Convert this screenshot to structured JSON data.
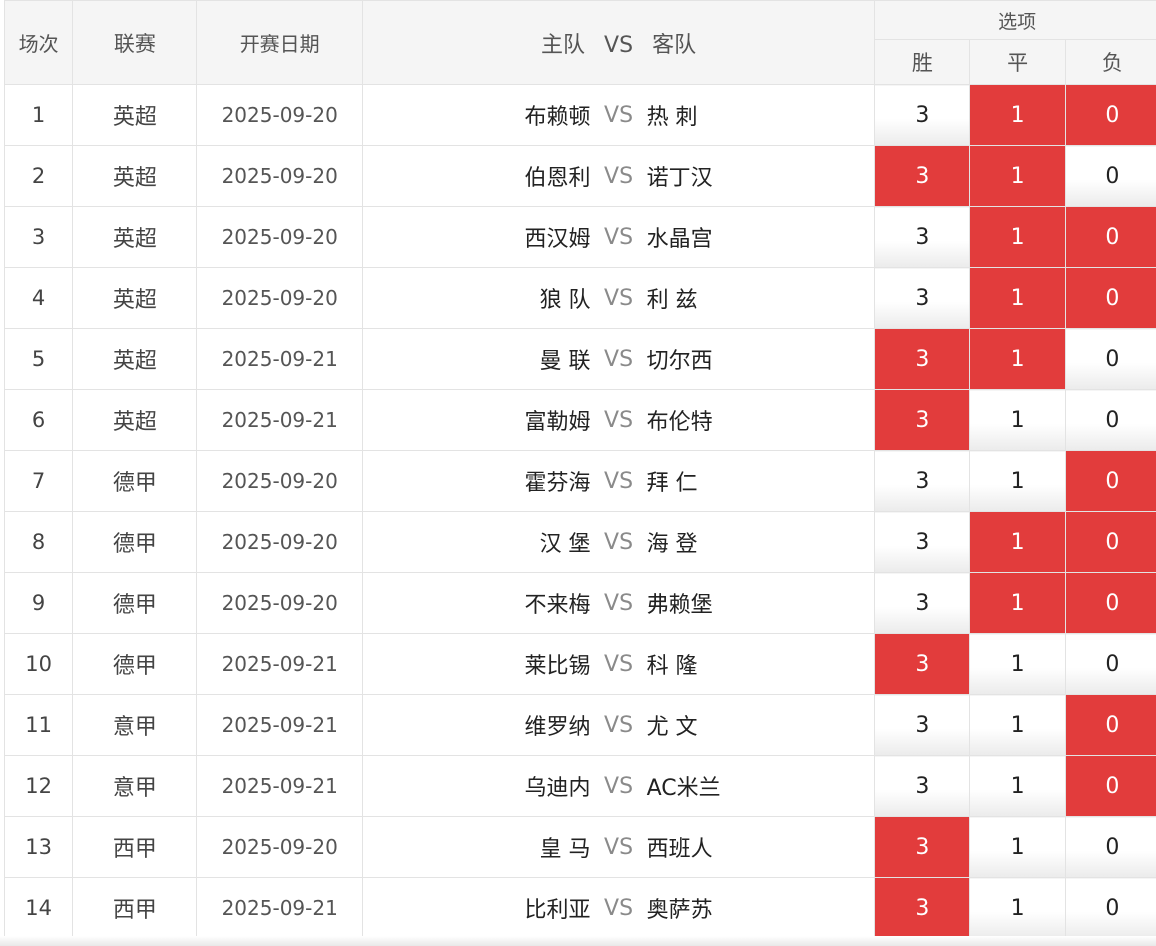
{
  "header": {
    "no": "场次",
    "league": "联赛",
    "date": "开赛日期",
    "home": "主队",
    "vs": "VS",
    "away": "客队",
    "options": "选项",
    "win": "胜",
    "draw": "平",
    "lose": "负"
  },
  "colors": {
    "selected": "#e23c3c"
  },
  "rows": [
    {
      "no": "1",
      "league": "英超",
      "date": "2025-09-20",
      "home": "布赖顿",
      "vs": "VS",
      "away": "热 刺",
      "w": "3",
      "d": "1",
      "l": "0",
      "sel": [
        "d",
        "l"
      ]
    },
    {
      "no": "2",
      "league": "英超",
      "date": "2025-09-20",
      "home": "伯恩利",
      "vs": "VS",
      "away": "诺丁汉",
      "w": "3",
      "d": "1",
      "l": "0",
      "sel": [
        "w",
        "d"
      ]
    },
    {
      "no": "3",
      "league": "英超",
      "date": "2025-09-20",
      "home": "西汉姆",
      "vs": "VS",
      "away": "水晶宫",
      "w": "3",
      "d": "1",
      "l": "0",
      "sel": [
        "d",
        "l"
      ]
    },
    {
      "no": "4",
      "league": "英超",
      "date": "2025-09-20",
      "home": "狼 队",
      "vs": "VS",
      "away": "利 兹",
      "w": "3",
      "d": "1",
      "l": "0",
      "sel": [
        "d",
        "l"
      ]
    },
    {
      "no": "5",
      "league": "英超",
      "date": "2025-09-21",
      "home": "曼 联",
      "vs": "VS",
      "away": "切尔西",
      "w": "3",
      "d": "1",
      "l": "0",
      "sel": [
        "w",
        "d"
      ]
    },
    {
      "no": "6",
      "league": "英超",
      "date": "2025-09-21",
      "home": "富勒姆",
      "vs": "VS",
      "away": "布伦特",
      "w": "3",
      "d": "1",
      "l": "0",
      "sel": [
        "w"
      ]
    },
    {
      "no": "7",
      "league": "德甲",
      "date": "2025-09-20",
      "home": "霍芬海",
      "vs": "VS",
      "away": "拜 仁",
      "w": "3",
      "d": "1",
      "l": "0",
      "sel": [
        "l"
      ]
    },
    {
      "no": "8",
      "league": "德甲",
      "date": "2025-09-20",
      "home": "汉 堡",
      "vs": "VS",
      "away": "海 登",
      "w": "3",
      "d": "1",
      "l": "0",
      "sel": [
        "d",
        "l"
      ]
    },
    {
      "no": "9",
      "league": "德甲",
      "date": "2025-09-20",
      "home": "不来梅",
      "vs": "VS",
      "away": "弗赖堡",
      "w": "3",
      "d": "1",
      "l": "0",
      "sel": [
        "d",
        "l"
      ]
    },
    {
      "no": "10",
      "league": "德甲",
      "date": "2025-09-21",
      "home": "莱比锡",
      "vs": "VS",
      "away": "科 隆",
      "w": "3",
      "d": "1",
      "l": "0",
      "sel": [
        "w"
      ]
    },
    {
      "no": "11",
      "league": "意甲",
      "date": "2025-09-21",
      "home": "维罗纳",
      "vs": "VS",
      "away": "尤 文",
      "w": "3",
      "d": "1",
      "l": "0",
      "sel": [
        "l"
      ]
    },
    {
      "no": "12",
      "league": "意甲",
      "date": "2025-09-21",
      "home": "乌迪内",
      "vs": "VS",
      "away": "AC米兰",
      "w": "3",
      "d": "1",
      "l": "0",
      "sel": [
        "l"
      ]
    },
    {
      "no": "13",
      "league": "西甲",
      "date": "2025-09-20",
      "home": "皇 马",
      "vs": "VS",
      "away": "西班人",
      "w": "3",
      "d": "1",
      "l": "0",
      "sel": [
        "w"
      ]
    },
    {
      "no": "14",
      "league": "西甲",
      "date": "2025-09-21",
      "home": "比利亚",
      "vs": "VS",
      "away": "奥萨苏",
      "w": "3",
      "d": "1",
      "l": "0",
      "sel": [
        "w"
      ]
    }
  ]
}
